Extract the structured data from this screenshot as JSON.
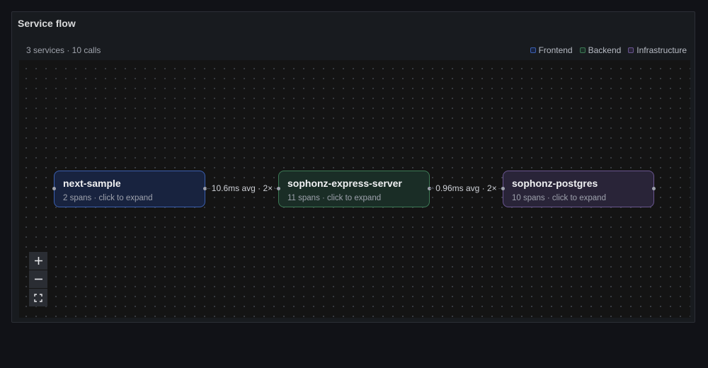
{
  "panel": {
    "title": "Service flow"
  },
  "summary": "3 services · 10 calls",
  "legend": [
    {
      "label": "Frontend",
      "color": "#3b5fb0"
    },
    {
      "label": "Backend",
      "color": "#3c7a55"
    },
    {
      "label": "Infrastructure",
      "color": "#6a5690"
    }
  ],
  "nodes": [
    {
      "name": "next-sample",
      "sub": "2 spans · click to expand",
      "fill": "#18233f",
      "border": "#3b5fb0"
    },
    {
      "name": "sophonz-express-server",
      "sub": "11 spans · click to expand",
      "fill": "#1a2d26",
      "border": "#3c7a55"
    },
    {
      "name": "sophonz-postgres",
      "sub": "10 spans · click to expand",
      "fill": "#292438",
      "border": "#6a5690"
    }
  ],
  "edges": [
    {
      "label": "10.6ms avg · 2×"
    },
    {
      "label": "0.96ms avg · 2×"
    }
  ],
  "zoom": {
    "in_icon": "plus-icon",
    "out_icon": "minus-icon",
    "fit_icon": "fit-view-icon"
  }
}
